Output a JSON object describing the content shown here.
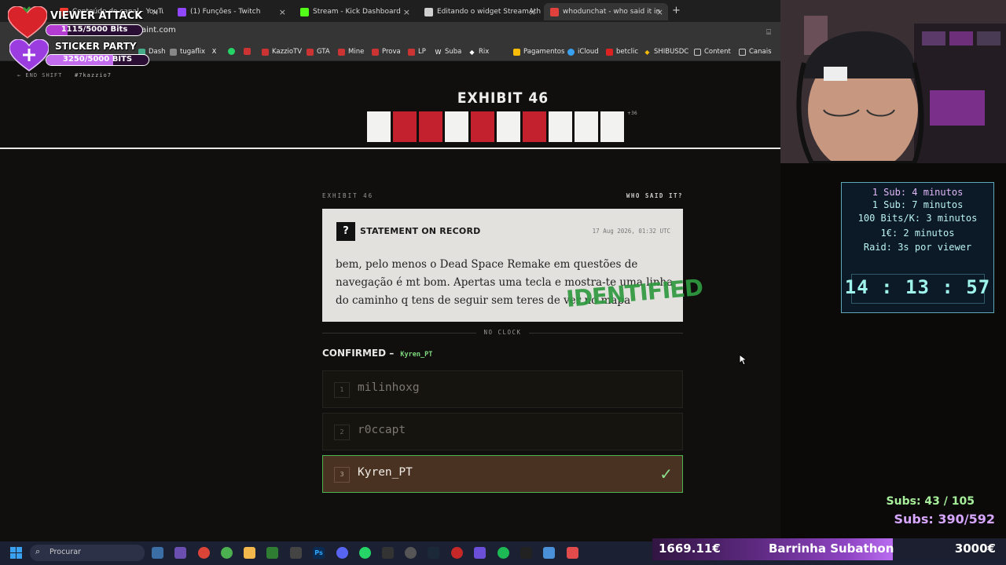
{
  "browser": {
    "tabs": [
      {
        "title": "Conteúdo do canal - YouTube S",
        "color": "#ff3b30"
      },
      {
        "title": "(1) Funções - Twitch",
        "color": "#9146ff"
      },
      {
        "title": "Stream - Kick Dashboard",
        "color": "#53fc18"
      },
      {
        "title": "Editando o widget StreamAthon",
        "color": "#cfcfcf"
      },
      {
        "title": "whodunchat - who said it in",
        "color": "#e0413c"
      }
    ],
    "url_fragment": "aint.com",
    "bookmarks": [
      "Dash",
      "tugaflix",
      "",
      "",
      "KazzioTV",
      "GTA",
      "Mine",
      "Prova",
      "LP",
      "Suba",
      "Rix",
      "Pagamentos",
      "iCloud",
      "betclic",
      "SHIBUSDC",
      "Content",
      "Canais"
    ]
  },
  "overlay": {
    "viewer_attack": "VIEWER ATTACK",
    "bits_progress": "1115/5000 Bits",
    "bits_fraction": 0.223,
    "sticker_party": "STICKER PARTY",
    "sticker_progress": "3250/5000 BITS",
    "sticker_fraction": 0.65
  },
  "game": {
    "end_shift": "← END SHIFT",
    "channel": "#7kazzio7",
    "exhibit_title": "EXHIBIT 46",
    "tiles": [
      "white",
      "red",
      "red",
      "white",
      "red",
      "white",
      "red",
      "white",
      "white",
      "white"
    ],
    "tiles_more": "+36",
    "card_header_left": "EXHIBIT 46",
    "card_header_right": "WHO SAID IT?",
    "question_icon": "?",
    "statement_label": "STATEMENT ON RECORD",
    "statement_date": "17 Aug 2026, 01:32 UTC",
    "statement_text": "bem, pelo menos o Dead Space Remake em questões de navegação é mt bom. Apertas uma tecla e mostra-te uma linha do caminho q tens de seguir sem teres de ver no mapa",
    "stamp": "IDENTIFIED",
    "no_clock": "NO CLOCK",
    "confirmed_label": "CONFIRMED –",
    "confirmed_name": "Kyren_PT",
    "guesses": [
      {
        "num": "1",
        "name": "milinhoxg"
      },
      {
        "num": "2",
        "name": "r0ccapt"
      },
      {
        "num": "3",
        "name": "Kyren_PT"
      }
    ],
    "check": "✓"
  },
  "timer": {
    "lines": [
      "1 Sub: 4 minutos",
      "1 Sub: 7 minutos",
      "100 Bits/K: 3 minutos",
      "1€: 2 minutos",
      "Raid: 3s por viewer"
    ],
    "clock": "14 : 13 : 57"
  },
  "subs": {
    "line1": "Subs: 43 / 105",
    "line2": "Subs: 390/592"
  },
  "taskbar": {
    "search": "Procurar"
  },
  "subathon": {
    "left": "1669.11€",
    "middle": "Barrinha Subathon",
    "right": "3000€",
    "fraction": 0.556
  },
  "colors": {
    "tile_red": "#c4212e",
    "tile_white": "#f2f2f0",
    "accent_green": "#4eb54e"
  }
}
